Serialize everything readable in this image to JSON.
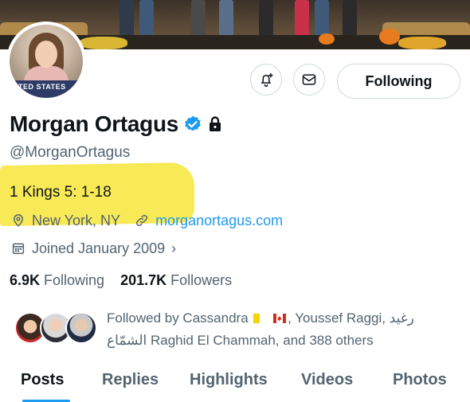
{
  "profile": {
    "name": "Morgan Ortagus",
    "handle": "@MorganOrtagus",
    "bio": "1 Kings 5: 1-18",
    "location": "New York, NY",
    "website": "morganortagus.com",
    "joined": "Joined January 2009",
    "avatar_podium_text": "ITED STATES",
    "verified_icon": "verified-badge-icon",
    "protected_icon": "lock-icon"
  },
  "actions": {
    "notify_icon": "bell-plus-icon",
    "message_icon": "envelope-icon",
    "follow_label": "Following"
  },
  "stats": {
    "following_count": "6.9K",
    "following_label": "Following",
    "followers_count": "201.7K",
    "followers_label": "Followers"
  },
  "followed_by": {
    "prefix": "Followed by Cassandra",
    "middle": ", Youssef Raggi, رغيد",
    "line2": "الشمّاع Raghid El Chammah, and 388 others"
  },
  "tabs": [
    {
      "label": "Posts"
    },
    {
      "label": "Replies"
    },
    {
      "label": "Highlights"
    },
    {
      "label": "Videos"
    },
    {
      "label": "Photos"
    }
  ],
  "colors": {
    "accent": "#1d9bf0",
    "highlight": "#f7e53a",
    "muted_text": "#536471"
  }
}
